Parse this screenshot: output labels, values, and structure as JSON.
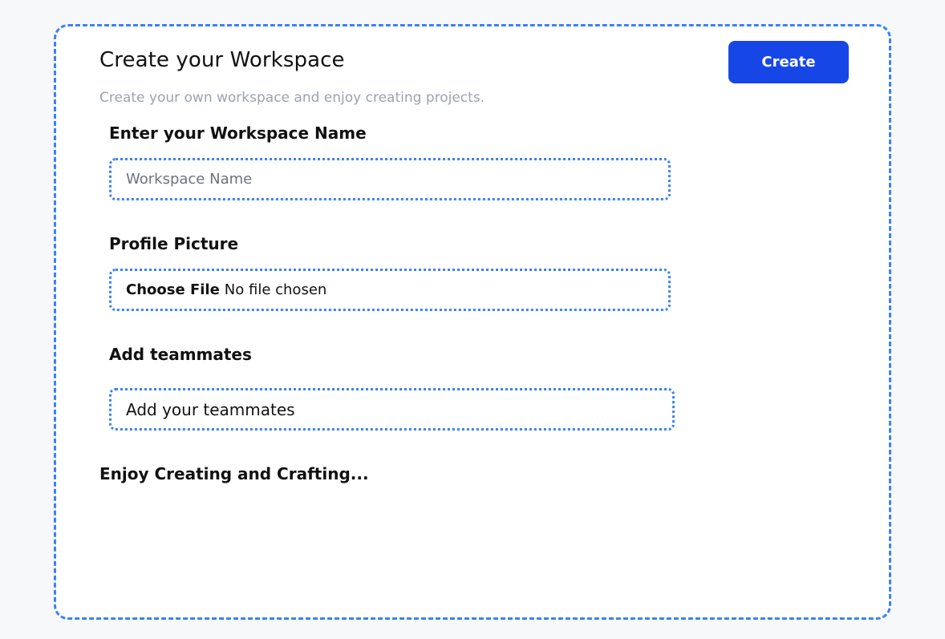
{
  "header": {
    "title": "Create your Workspace",
    "subtitle": "Create your own workspace and enjoy creating projects.",
    "create_label": "Create"
  },
  "workspace_name": {
    "label": "Enter your Workspace Name",
    "placeholder": "Workspace Name",
    "value": ""
  },
  "profile_picture": {
    "label": "Profile Picture",
    "button_label": "Choose File",
    "status": "No file chosen"
  },
  "teammates": {
    "label": "Add teammates",
    "text": "Add your teammates"
  },
  "footer": {
    "text": "Enjoy Creating and Crafting..."
  },
  "colors": {
    "accent": "#3b82f6",
    "button": "#1746e6",
    "background": "#f7f8fa",
    "muted_text": "#9ca3af"
  }
}
